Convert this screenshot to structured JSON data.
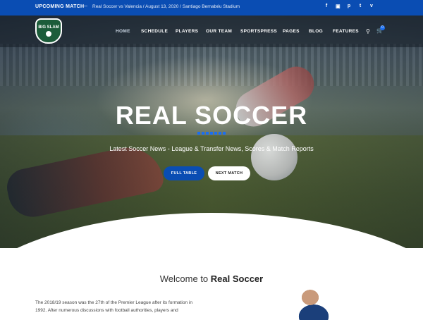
{
  "topbar": {
    "label": "UPCOMING MATCH",
    "separator": "—",
    "match": "Real Soccer vs Valencia / August 13, 2020 / Santiago Bernabéu Stadium",
    "social": [
      {
        "name": "facebook-icon",
        "glyph": "f"
      },
      {
        "name": "flickr-icon",
        "glyph": "▣"
      },
      {
        "name": "pinterest-icon",
        "glyph": "p"
      },
      {
        "name": "twitter-icon",
        "glyph": "t"
      },
      {
        "name": "vimeo-icon",
        "glyph": "v"
      }
    ]
  },
  "logo": {
    "text": "BIG SLAM"
  },
  "nav": {
    "items": [
      "HOME",
      "SCHEDULE",
      "PLAYERS",
      "OUR TEAM",
      "SPORTSPRESS",
      "PAGES",
      "BLOG",
      "FEATURES"
    ],
    "active": "HOME",
    "cart_count": "0"
  },
  "hero": {
    "title": "REAL SOCCER",
    "subtitle": "Latest Soccer News - League & Transfer News, Scores & Match Reports",
    "primary_button": "FULL TABLE",
    "secondary_button": "NEXT MATCH"
  },
  "welcome": {
    "prefix": "Welcome to ",
    "brand": "Real Soccer",
    "paragraph": "The 2018/19 season was the 27th of the Premier League after its formation in 1992. After numerous discussions with football authorities, players and"
  },
  "colors": {
    "accent": "#0a4db3",
    "topbar": "#0a4db3",
    "dots": "#1a6ef0"
  }
}
